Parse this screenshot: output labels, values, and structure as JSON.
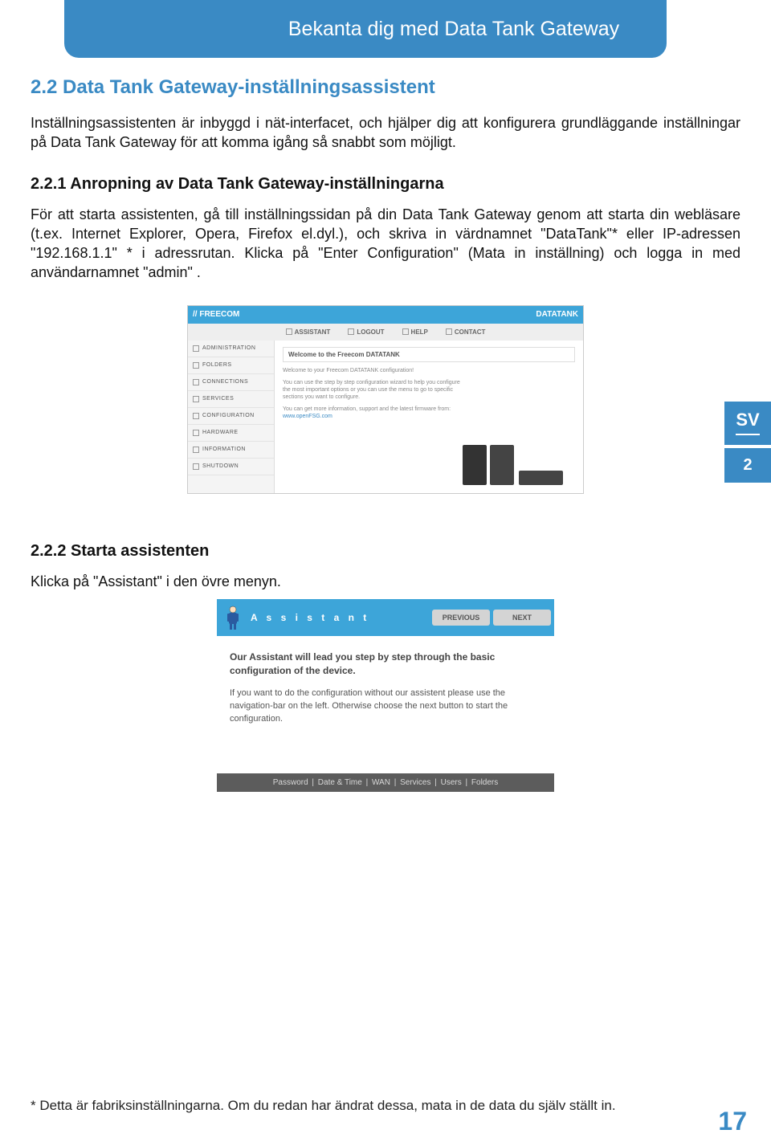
{
  "header": {
    "title": "Bekanta dig med Data Tank Gateway"
  },
  "section22": {
    "title": "2.2 Data Tank Gateway-inställningsassistent",
    "body": "Inställningsassistenten är inbyggd i nät-interfacet, och hjälper dig att konfigurera grundläggande inställningar på Data Tank Gateway för att komma igång så snabbt som möjligt."
  },
  "section221": {
    "title": "2.2.1 Anropning av Data Tank Gateway-inställningarna",
    "body": "För att starta assistenten, gå till inställningssidan på din Data Tank Gateway genom att starta din webläsare (t.ex. Internet Explorer, Opera, Firefox el.dyl.), och skriva in värdnamnet \"DataTank\"* eller IP-adressen \"192.168.1.1\" * i adressrutan. Klicka på \"Enter Configuration\" (Mata in inställning) och logga in med användarnamnet \"admin\" ."
  },
  "section222": {
    "title": "2.2.2 Starta assistenten",
    "body": "Klicka på \"Assistant\" i den övre menyn."
  },
  "side": {
    "lang": "SV",
    "chapter": "2"
  },
  "screenshot1": {
    "brand": "// FREECOM",
    "brand_right": "DATATANK",
    "nav": [
      "ASSISTANT",
      "LOGOUT",
      "HELP",
      "CONTACT"
    ],
    "sidebar": [
      "ADMINISTRATION",
      "FOLDERS",
      "CONNECTIONS",
      "SERVICES",
      "CONFIGURATION",
      "HARDWARE",
      "INFORMATION",
      "SHUTDOWN"
    ],
    "welcome_bar": "Welcome to the Freecom DATATANK",
    "line1": "Welcome to your Freecom DATATANK configuration!",
    "line2": "You can use the step by step configuration wizard to help you configure the most important options or you can use the menu to go to specific sections you want to configure.",
    "line3": "You can get more information, support and the latest firmware from:",
    "link": "www.openFSG.com"
  },
  "screenshot2": {
    "title": "A s s i s t a n t",
    "prev": "PREVIOUS",
    "next": "NEXT",
    "bold": "Our Assistant will lead you step by step through the basic configuration of the device.",
    "plain": "If you want to do the configuration without our assistent please use the navigation-bar on the left. Otherwise choose the next button to start the configuration.",
    "footer": [
      "Password",
      "Date & Time",
      "WAN",
      "Services",
      "Users",
      "Folders"
    ]
  },
  "footnote": "* Detta är fabriksinställningarna. Om du redan har ändrat dessa, mata in de data du själv ställt in.",
  "pagenum": "17"
}
